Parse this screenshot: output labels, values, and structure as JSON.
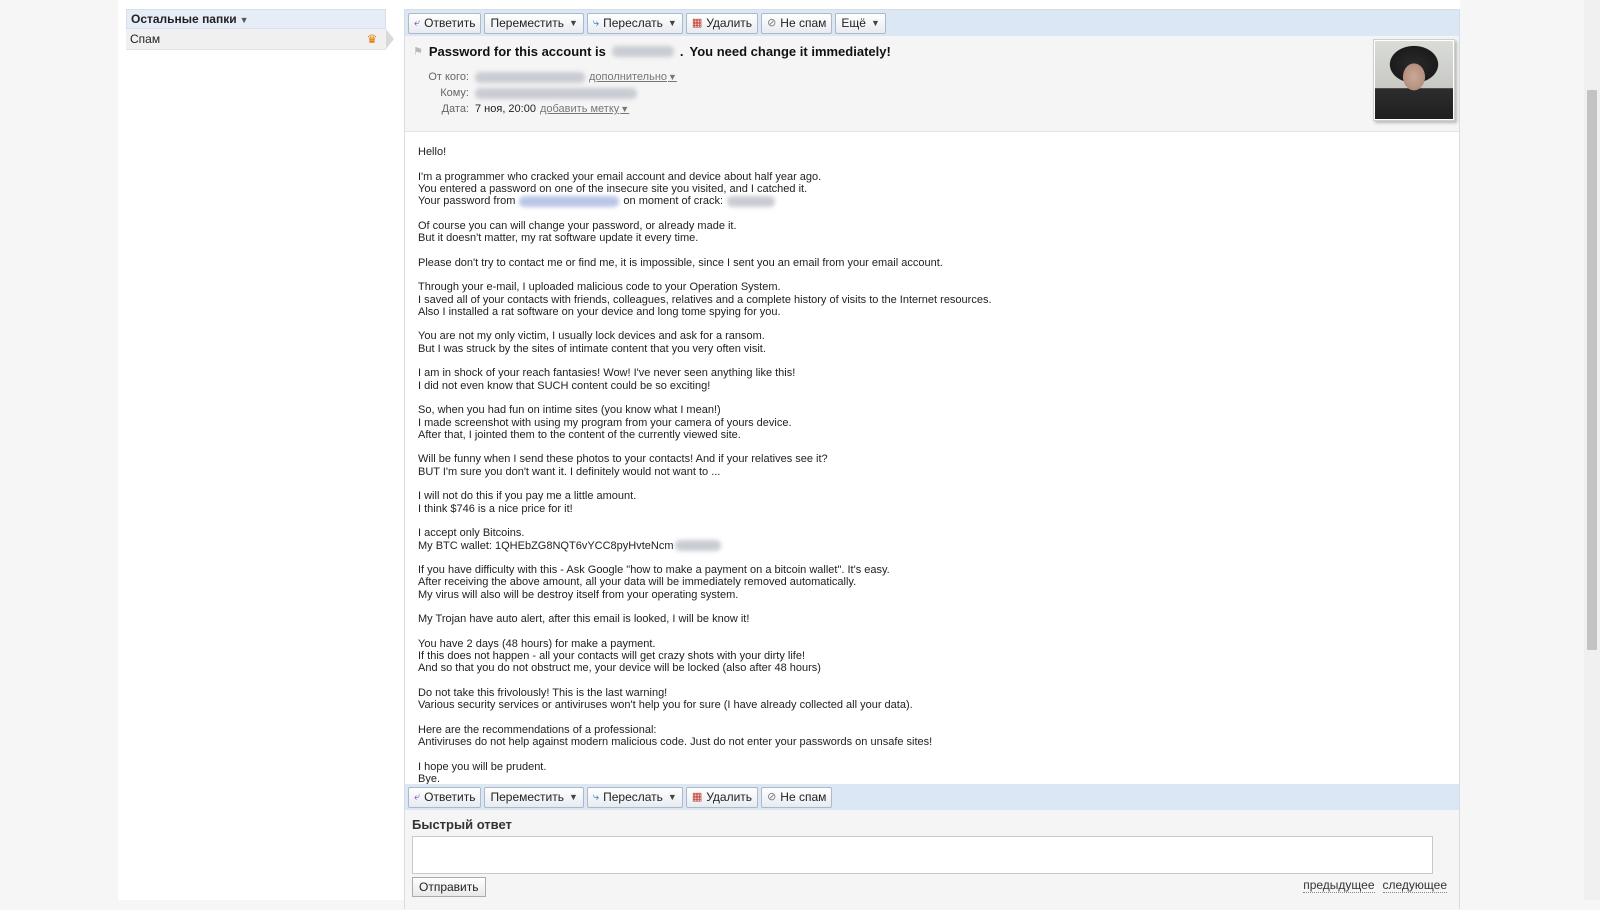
{
  "sidebar": {
    "folders_header": "Остальные папки",
    "spam_folder": "Спам"
  },
  "toolbar": {
    "reply": "Ответить",
    "move": "Переместить",
    "forward": "Переслать",
    "delete": "Удалить",
    "not_spam": "Не спам",
    "more": "Ещё"
  },
  "message": {
    "subject_prefix": "Password for this account is",
    "subject_suffix": "You need change it immediately!",
    "from_label": "От кого:",
    "from_more": "дополнительно",
    "to_label": "Кому:",
    "date_label": "Дата:",
    "date_value": "7 ноя, 20:00",
    "add_label": "добавить метку",
    "paragraphs": [
      [
        "Hello!"
      ],
      [
        "I'm a programmer who cracked your email account and device about half year ago.",
        "You entered a password on one of the insecure site you visited, and I catched it.",
        "Your password from"
      ],
      [
        "Of course you can will change your password, or already made it.",
        "But it doesn't matter, my rat software update it every time."
      ],
      [
        "Please don't try to contact me or find me, it is impossible, since I sent you an email from your email account."
      ],
      [
        "Through your e-mail, I uploaded malicious code to your Operation System.",
        "I saved all of your contacts with friends, colleagues, relatives and a complete history of visits to the Internet resources.",
        "Also I installed a rat software on your device and long tome spying for you."
      ],
      [
        "You are not my only victim, I usually lock devices and ask for a ransom.",
        "But I was struck by the sites of intimate content that you very often visit."
      ],
      [
        "I am in shock of your reach fantasies! Wow! I've never seen anything like this!",
        "I did not even know that SUCH content could be so exciting!"
      ],
      [
        "So, when you had fun on intime sites (you know what I mean!)",
        "I made screenshot with using my program from your camera of yours device.",
        "After that, I jointed them to the content of the currently viewed site."
      ],
      [
        "Will be funny when I send these photos to your contacts! And if your relatives see it?",
        "BUT I'm sure you don't want it. I definitely would not want to ..."
      ],
      [
        "I will not do this if you pay me a little amount.",
        "I think $746 is a nice price for it!"
      ],
      [
        "I accept only Bitcoins.",
        "My BTC wallet: 1QHEbZG8NQT6vYCC8pyHvteNcm"
      ],
      [
        "If you have difficulty with this - Ask Google \"how to make a payment on a bitcoin wallet\". It's easy.",
        "After receiving the above amount, all your data will be immediately removed automatically.",
        "My virus will also will be destroy itself from your operating system."
      ],
      [
        "My Trojan have auto alert, after this email is looked, I will be know it!"
      ],
      [
        "You have 2 days (48 hours) for make a payment.",
        "If this does not happen - all your contacts will get crazy shots with your dirty life!",
        "And so that you do not obstruct me, your device will be locked (also after 48 hours)"
      ],
      [
        "Do not take this frivolously! This is the last warning!",
        "Various security services or antiviruses won't help you for sure (I have already collected all your data)."
      ],
      [
        "Here are the recommendations of a professional:",
        "Antiviruses do not help against modern malicious code. Just do not enter your passwords on unsafe sites!"
      ],
      [
        "I hope you will be prudent.",
        "Bye."
      ]
    ],
    "crack_phrase": "on moment of crack:"
  },
  "quick_reply": {
    "title": "Быстрый ответ",
    "send": "Отправить",
    "prev": "предыдущее",
    "next": "следующее"
  },
  "icons": {
    "reply": "reply-icon",
    "forward": "forward-icon",
    "delete": "trash-icon",
    "not_spam": "not-spam-icon",
    "spam_folder": "spam-folder-icon"
  }
}
